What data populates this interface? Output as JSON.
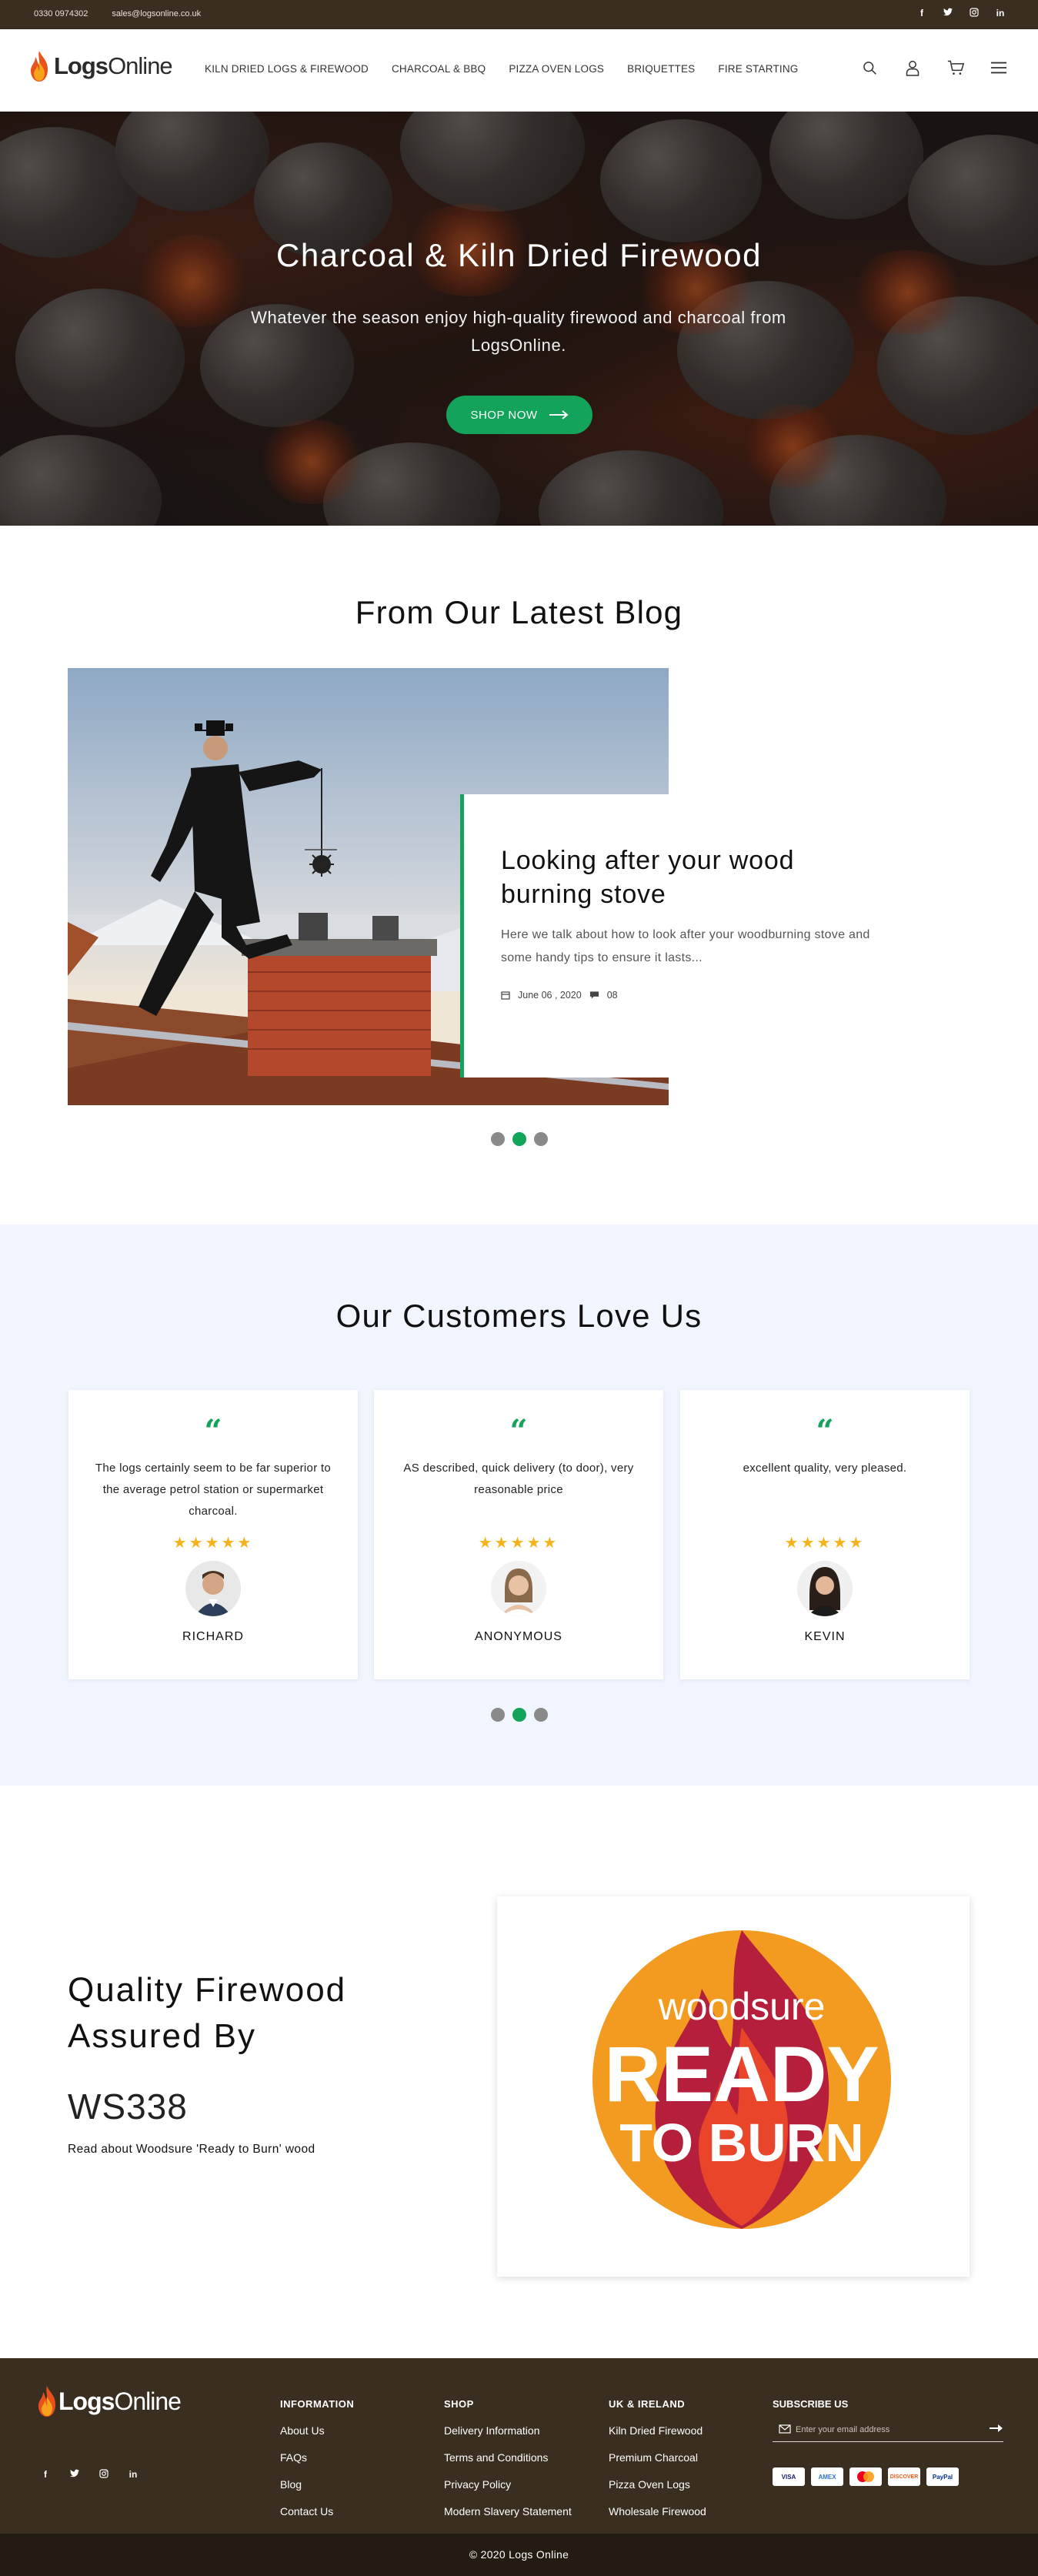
{
  "topbar": {
    "phone": "0330 0974302",
    "email": "sales@logsonline.co.uk",
    "social": [
      "f",
      "t",
      "ig",
      "in"
    ]
  },
  "header": {
    "logo_bold": "Logs",
    "logo_light": "Online",
    "nav": [
      "KILN DRIED LOGS & FIREWOOD",
      "CHARCOAL & BBQ",
      "PIZZA OVEN LOGS",
      "BRIQUETTES",
      "FIRE STARTING"
    ],
    "icons": [
      "search-icon",
      "user-icon",
      "cart-icon",
      "menu-icon"
    ]
  },
  "hero": {
    "title": "Charcoal & Kiln Dried Firewood",
    "subtitle": "Whatever the season enjoy high-quality firewood and charcoal from LogsOnline.",
    "button": "SHOP NOW"
  },
  "blog": {
    "section_title": "From Our Latest Blog",
    "post_title": "Looking after your wood burning stove",
    "excerpt": "Here we talk about how to look after your woodburning stove and some handy tips to ensure it lasts...",
    "date": "June 06 , 2020",
    "comments": "08",
    "active_slide": 2
  },
  "testimonials": {
    "section_title": "Our Customers Love Us",
    "items": [
      {
        "text": "The logs certainly seem to be far superior to the average petrol station or supermarket charcoal.",
        "name": "RICHARD",
        "stars": 5
      },
      {
        "text": "AS described, quick delivery (to door), very reasonable price",
        "name": "ANONYMOUS",
        "stars": 5
      },
      {
        "text": "excellent quality, very pleased.",
        "name": "KEVIN",
        "stars": 5
      }
    ],
    "active_slide": 2
  },
  "quality": {
    "title": "Quality Firewood Assured By",
    "code": "WS338",
    "link": "Read about Woodsure 'Ready to Burn' wood",
    "badge_top": "woodsure",
    "badge_mid": "READY",
    "badge_bottom": "TO BURN"
  },
  "footer": {
    "columns": [
      {
        "heading": "INFORMATION",
        "links": [
          "About Us",
          "FAQs",
          "Blog",
          "Contact Us"
        ]
      },
      {
        "heading": "SHOP",
        "links": [
          "Delivery Information",
          "Terms and Conditions",
          "Privacy Policy",
          "Modern Slavery Statement"
        ]
      },
      {
        "heading": "UK & IRELAND",
        "links": [
          "Kiln Dried Firewood",
          "Premium Charcoal",
          "Pizza Oven Logs",
          "Wholesale Firewood"
        ]
      }
    ],
    "subscribe_heading": "SUBSCRIBE US",
    "subscribe_placeholder": "Enter your email address",
    "payments": [
      "VISA",
      "AMEX",
      "MC",
      "DISCOVER",
      "PayPal"
    ],
    "copyright": "© 2020 Logs Online"
  },
  "colors": {
    "brand_green": "#13a35b",
    "footer_brown": "#3a2e20",
    "star_yellow": "#f6b21b",
    "testimonial_bg": "#f1f5fe"
  }
}
